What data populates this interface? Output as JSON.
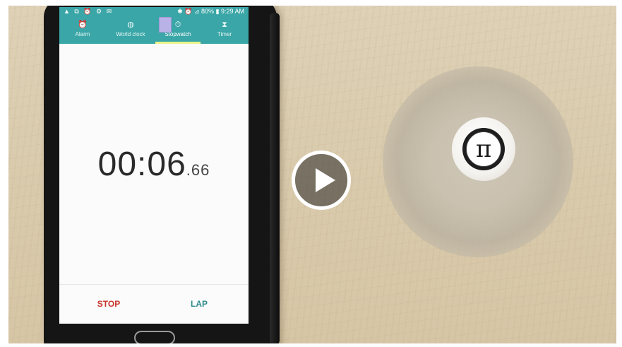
{
  "status_bar": {
    "left_icons": "▲ ⧉ ⏰ ⚙ ✉",
    "right_text": "✱ ⏰ ⊿ 80% ▮ 9:29 AM"
  },
  "tabs": [
    {
      "label": "Alarm",
      "icon": "⏰",
      "icon_name": "alarm-icon"
    },
    {
      "label": "World clock",
      "icon": "◍",
      "icon_name": "world-clock-icon"
    },
    {
      "label": "Stopwatch",
      "icon": "⏱",
      "icon_name": "stopwatch-icon",
      "active": true
    },
    {
      "label": "Timer",
      "icon": "⧗",
      "icon_name": "timer-icon"
    }
  ],
  "stopwatch": {
    "time_main": "00:06",
    "time_fraction": ".66"
  },
  "buttons": {
    "stop_label": "STOP",
    "lap_label": "LAP"
  },
  "spinner": {
    "cap_symbol": "π"
  },
  "colors": {
    "accent": "#3aa6a7",
    "stop": "#c8342c",
    "lap": "#2f8c8e"
  }
}
